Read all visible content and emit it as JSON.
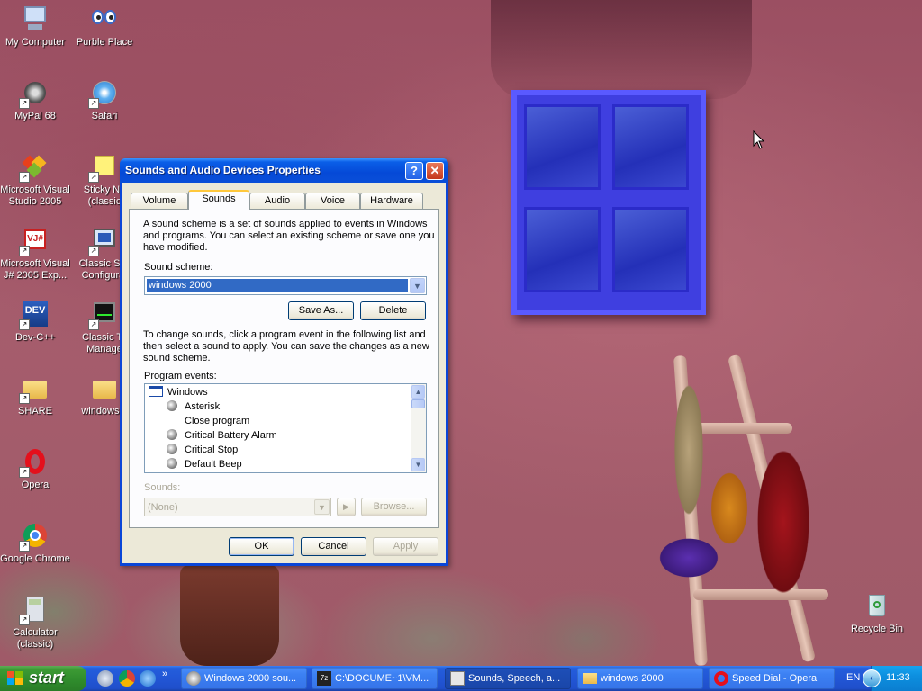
{
  "desktop": {
    "icons": [
      {
        "label": "My Computer",
        "icon": "my-computer-icon"
      },
      {
        "label": "Purble Place",
        "icon": "purble-place-icon"
      },
      {
        "label": "MyPal 68",
        "icon": "mypal-icon"
      },
      {
        "label": "Safari",
        "icon": "safari-icon"
      },
      {
        "label": "Microsoft Visual\nStudio 2005",
        "icon": "visual-studio-icon"
      },
      {
        "label": "Sticky No\n(classic",
        "icon": "sticky-notes-icon"
      },
      {
        "label": "Microsoft Visual\nJ# 2005 Exp...",
        "icon": "visual-jsharp-icon"
      },
      {
        "label": "Classic Sys\nConfigurat",
        "icon": "system-config-icon"
      },
      {
        "label": "Dev-C++",
        "icon": "dev-cpp-icon"
      },
      {
        "label": "Classic Ta\nManage",
        "icon": "task-manager-icon"
      },
      {
        "label": "SHARE",
        "icon": "folder-icon"
      },
      {
        "label": "windows 2",
        "icon": "folder-icon"
      },
      {
        "label": "Opera",
        "icon": "opera-icon"
      },
      {
        "label": "Google Chrome",
        "icon": "chrome-icon"
      },
      {
        "label": "Calculator\n(classic)",
        "icon": "calculator-icon"
      },
      {
        "label": "Recycle Bin",
        "icon": "recycle-bin-icon"
      }
    ]
  },
  "dialog": {
    "title": "Sounds and Audio Devices Properties",
    "help_button": "?",
    "close_button": "✕",
    "tabs": [
      "Volume",
      "Sounds",
      "Audio",
      "Voice",
      "Hardware"
    ],
    "active_tab": "Sounds",
    "intro_text": "A sound scheme is a set of sounds applied to events in Windows\nand programs.  You can select an existing scheme or save one you\nhave modified.",
    "scheme_label": "Sound scheme:",
    "scheme_value": "windows 2000",
    "save_as_label": "Save As...",
    "delete_label": "Delete",
    "change_text": "To change sounds, click a program event in the following list and\nthen select a sound to apply.  You can save the changes as a new\nsound scheme.",
    "events_label": "Program events:",
    "events": [
      {
        "label": "Windows",
        "kind": "group"
      },
      {
        "label": "Asterisk",
        "kind": "sound"
      },
      {
        "label": "Close program",
        "kind": "none"
      },
      {
        "label": "Critical Battery Alarm",
        "kind": "sound"
      },
      {
        "label": "Critical Stop",
        "kind": "sound"
      },
      {
        "label": "Default Beep",
        "kind": "sound"
      }
    ],
    "sounds_label": "Sounds:",
    "sounds_value": "(None)",
    "play_label": "▶",
    "browse_label": "Browse...",
    "ok_label": "OK",
    "cancel_label": "Cancel",
    "apply_label": "Apply"
  },
  "taskbar": {
    "start_label": "start",
    "overflow_label": "»",
    "tasks": [
      {
        "label": "Windows 2000 sou...",
        "icon": "sound-task-icon"
      },
      {
        "label": "C:\\DOCUME~1\\VM...",
        "icon": "7zip-icon"
      },
      {
        "label": "Sounds, Speech, a...",
        "icon": "control-panel-icon"
      },
      {
        "label": "windows 2000",
        "icon": "folder-icon"
      },
      {
        "label": "Speed Dial - Opera",
        "icon": "opera-icon"
      }
    ],
    "language": "EN",
    "clock": "11:33"
  },
  "colors": {
    "xp_blue": "#0a46d8",
    "start_green": "#3c9a34",
    "selection": "#316ac5",
    "window_blue": "#3f3fe0"
  }
}
